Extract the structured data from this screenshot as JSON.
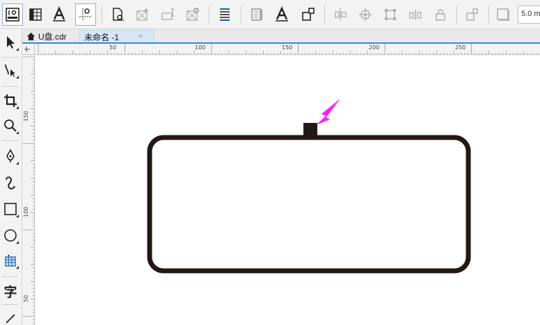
{
  "toolbar": {
    "items": [
      {
        "name": "options-icon"
      },
      {
        "name": "grid-icon"
      },
      {
        "name": "text-properties-icon"
      },
      {
        "name": "snap-guides-icon"
      },
      {
        "name": "object-manager-icon"
      },
      {
        "name": "add-frame-icon"
      },
      {
        "name": "insert-field-icon"
      },
      {
        "name": "remove-icon"
      },
      {
        "name": "align-icon"
      },
      {
        "name": "page-layout-icon"
      },
      {
        "name": "text-outline-icon"
      },
      {
        "name": "layer-order-icon"
      },
      {
        "name": "align-center-icon"
      },
      {
        "name": "target-icon"
      },
      {
        "name": "transform-icon"
      },
      {
        "name": "distribute-icon"
      },
      {
        "name": "lock-icon"
      },
      {
        "name": "back-front-icon"
      },
      {
        "name": "frame-icon"
      }
    ],
    "outline_width": "5.0 m"
  },
  "tabs": {
    "home_label": "U盘.cdr",
    "active_label": "未命名 -1",
    "add_label": "+"
  },
  "ruler": {
    "h_labels": [
      "50",
      "100",
      "150",
      "200",
      "250"
    ],
    "v_labels": [
      "150",
      "100",
      "50"
    ]
  },
  "toolbox": {
    "text_tool_label": "字"
  },
  "colors": {
    "accent": "#2f8ae0",
    "shape_stroke": "#231815",
    "arrow": "#ff22ff"
  }
}
